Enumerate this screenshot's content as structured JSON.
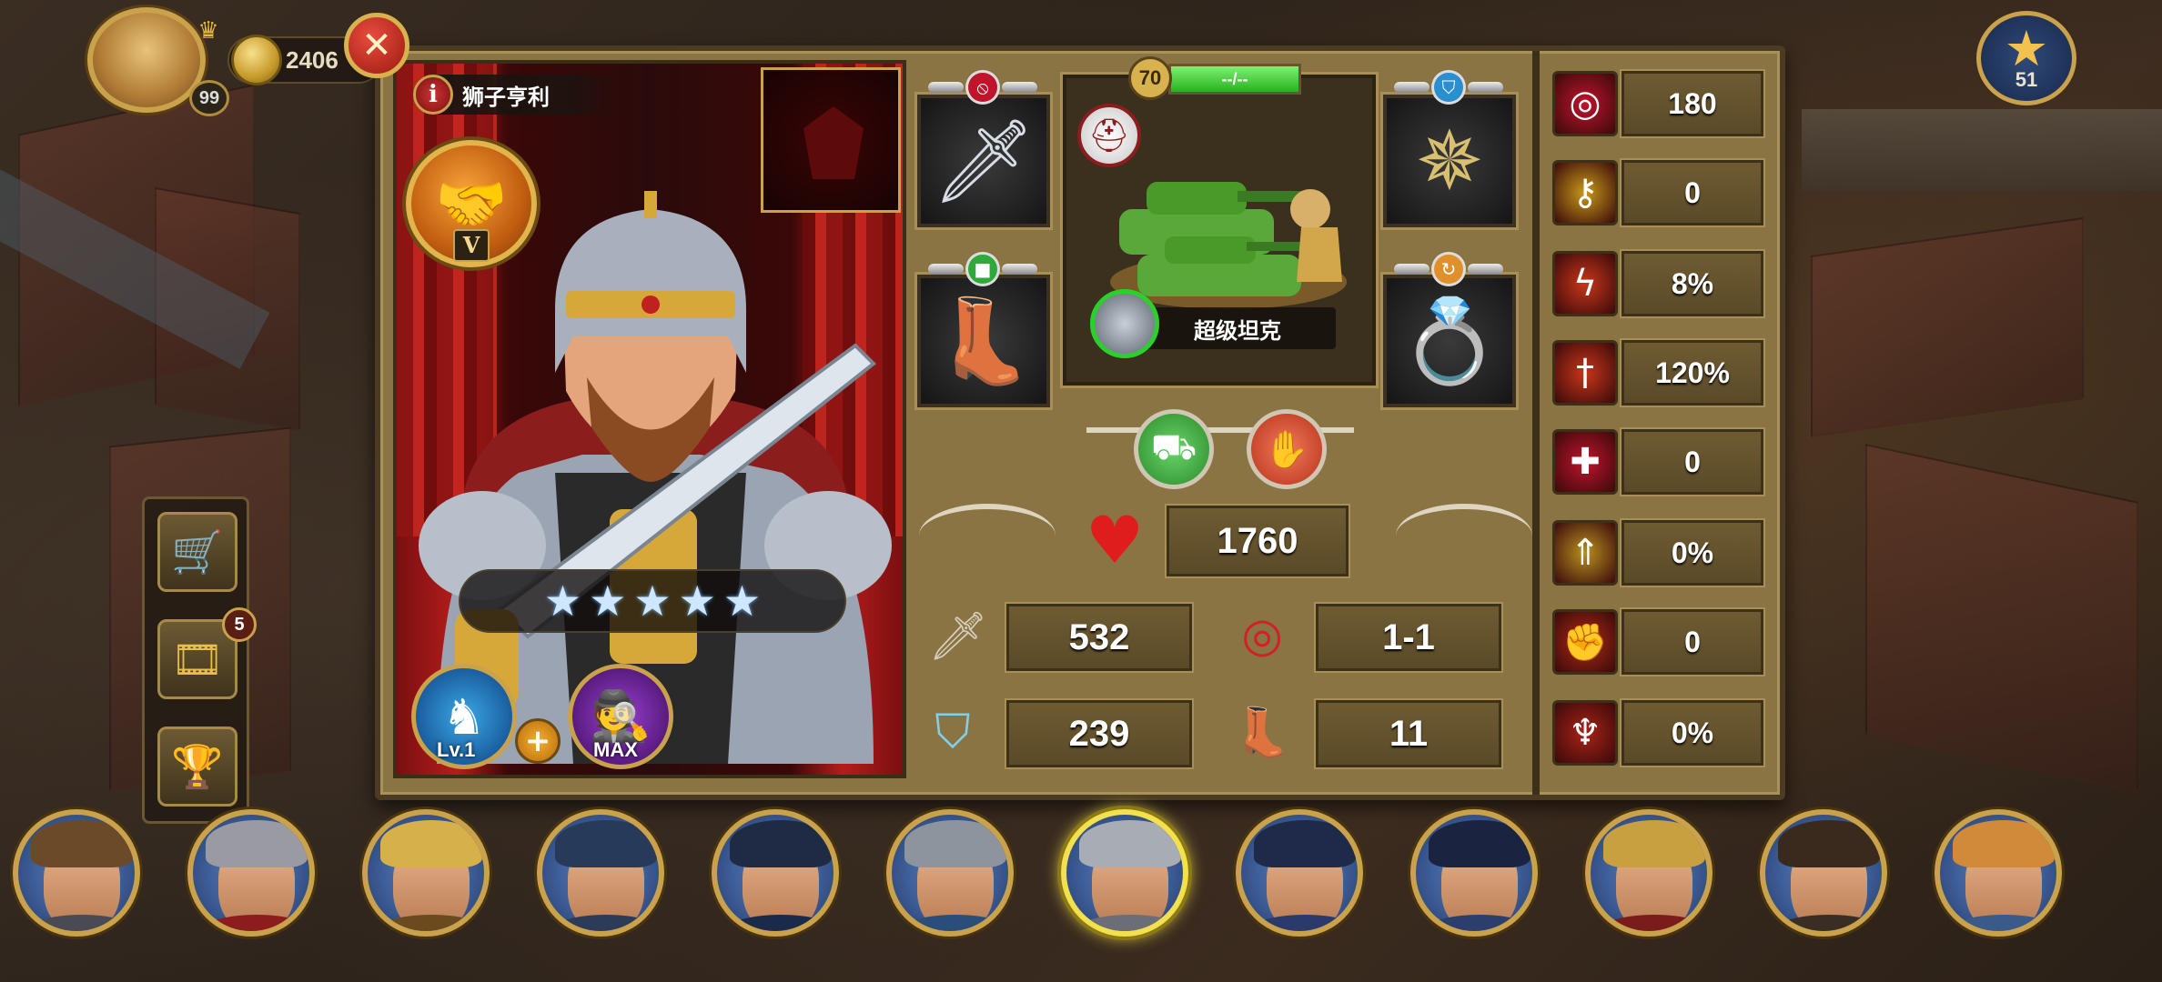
{
  "player": {
    "level": "99",
    "coins": "2406",
    "star_count": "51"
  },
  "hero": {
    "name": "狮子亨利",
    "rank": "V",
    "stars": [
      "★",
      "★",
      "★",
      "★",
      "★"
    ],
    "skill1_label": "Lv.1",
    "skill2_label": "MAX"
  },
  "tank": {
    "level": "70",
    "exp_text": "--/--",
    "exp_fraction": 1.0,
    "name": "超级坦克"
  },
  "stats": {
    "hp": "1760",
    "attack": "532",
    "range": "1-1",
    "defense": "239",
    "move": "11"
  },
  "right_stats": [
    {
      "icon": "crosshair-icon",
      "glyph": "◎",
      "color": "#c0142c",
      "value": "180"
    },
    {
      "icon": "key-icon",
      "glyph": "⚷",
      "color": "#c99a1a",
      "value": "0"
    },
    {
      "icon": "lightning-icon",
      "glyph": "ϟ",
      "color": "#c8361a",
      "value": "8%"
    },
    {
      "icon": "sword-fire-icon",
      "glyph": "†",
      "color": "#c8361a",
      "value": "120%"
    },
    {
      "icon": "medical-cross-icon",
      "glyph": "✚",
      "color": "#c0142c",
      "value": "0"
    },
    {
      "icon": "rank-up-icon",
      "glyph": "⇑",
      "color": "#b8901f",
      "value": "0%"
    },
    {
      "icon": "fist-icon",
      "glyph": "✊",
      "color": "#b02a16",
      "value": "0"
    },
    {
      "icon": "figure-burst-icon",
      "glyph": "♆",
      "color": "#a82218",
      "value": "0%"
    }
  ],
  "side_menu": {
    "badge": "5"
  },
  "hero_roster": [
    {
      "name": "hero-1",
      "hat": "#6b4a2a",
      "body": "#4a4a55"
    },
    {
      "name": "hero-2",
      "hat": "#9a9aa2",
      "body": "#8d1c1c"
    },
    {
      "name": "hero-3",
      "hat": "#d6b04a",
      "body": "#6a4a1e"
    },
    {
      "name": "hero-4",
      "hat": "#273a5a",
      "body": "#2c3b58"
    },
    {
      "name": "hero-5",
      "hat": "#1f2a44",
      "body": "#1a2a4a"
    },
    {
      "name": "hero-6",
      "hat": "#8e949e",
      "body": "#2a4e7a"
    },
    {
      "name": "hero-7",
      "hat": "#a8acb4",
      "body": "#6b6e76",
      "selected": true
    },
    {
      "name": "hero-8",
      "hat": "#1f2a4a",
      "body": "#2a3a6a"
    },
    {
      "name": "hero-9",
      "hat": "#1a2340",
      "body": "#2c3e6b"
    },
    {
      "name": "hero-10",
      "hat": "#c9a040",
      "body": "#7a1c1c"
    },
    {
      "name": "hero-11",
      "hat": "#3a2a1e",
      "body": "#3a2e24"
    },
    {
      "name": "hero-12",
      "hat": "#d08a3a",
      "body": "#3a5a8a"
    }
  ]
}
